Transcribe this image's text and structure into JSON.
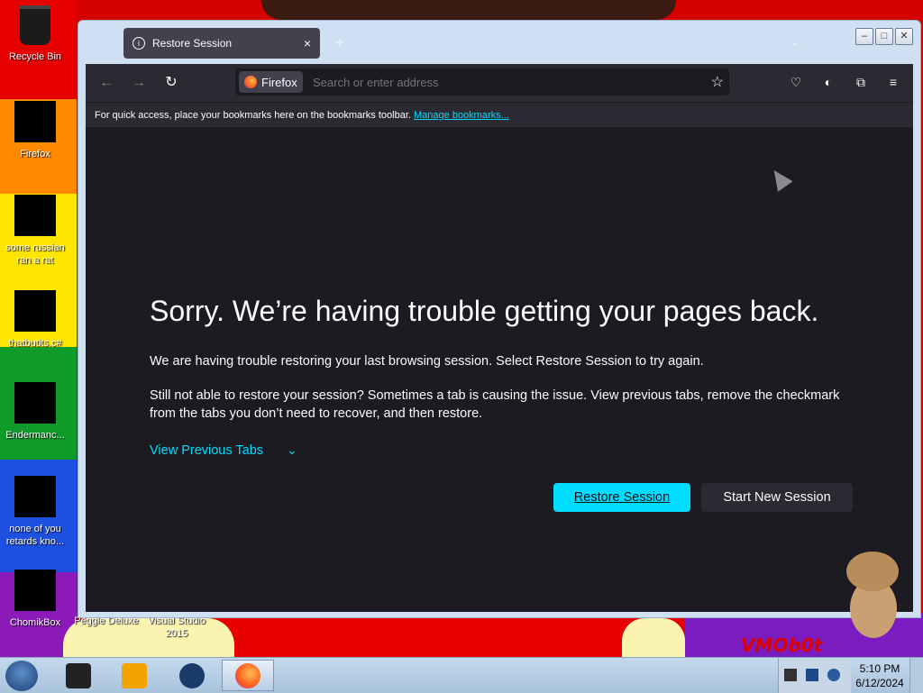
{
  "desktop": {
    "icons": [
      {
        "label": "Recycle Bin"
      },
      {
        "label": "Firefox"
      },
      {
        "label": "some russian ran a rat"
      },
      {
        "label": "thatbutits.c#"
      },
      {
        "label": "Endermanc..."
      },
      {
        "label": "none of you retards kno..."
      },
      {
        "label": "ChomikBox"
      },
      {
        "label": "Peggle Deluxe"
      },
      {
        "label": "Visual Studio 2015"
      }
    ],
    "watermark": "VMOb0t"
  },
  "browser": {
    "tab_title": "Restore Session",
    "tab_close": "×",
    "new_tab": "+",
    "identity_label": "Firefox",
    "url_placeholder": "Search or enter address",
    "bookmarks_message": "For quick access, place your bookmarks here on the bookmarks toolbar.",
    "manage_bookmarks": "Manage bookmarks...",
    "page": {
      "heading": "Sorry. We’re having trouble getting your pages back.",
      "paragraph1": "We are having trouble restoring your last browsing session. Select Restore Session to try again.",
      "paragraph2": "Still not able to restore your session? Sometimes a tab is causing the issue. View previous tabs, remove the checkmark from the tabs you don’t need to recover, and then restore.",
      "view_previous": "View Previous Tabs",
      "restore_button": "Restore Session",
      "new_session_button": "Start New Session"
    }
  },
  "taskbar": {
    "time": "5:10 PM",
    "date": "6/12/2024"
  },
  "colors": {
    "accent": "#00ddff",
    "page_bg": "#1c1b22",
    "toolbar_bg": "#2b2a33"
  }
}
